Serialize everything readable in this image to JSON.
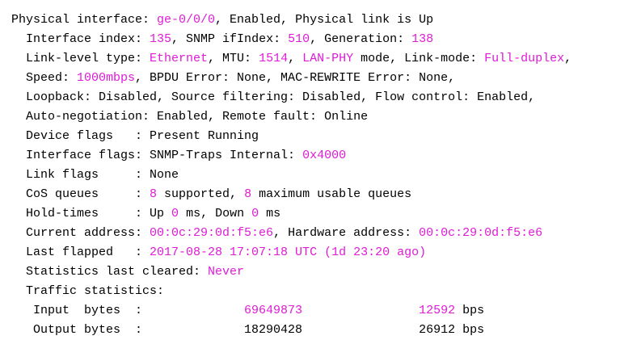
{
  "colors": {
    "text": "#000000",
    "highlight": "#e01bd6",
    "background": "#ffffff"
  },
  "lines": [
    [
      {
        "t": "Physical interface: "
      },
      {
        "t": "ge-0/0/0",
        "hl": true
      },
      {
        "t": ", Enabled, Physical link is Up"
      }
    ],
    [
      {
        "t": "  Interface index: "
      },
      {
        "t": "135",
        "hl": true
      },
      {
        "t": ", SNMP ifIndex: "
      },
      {
        "t": "510",
        "hl": true
      },
      {
        "t": ", Generation: "
      },
      {
        "t": "138",
        "hl": true
      }
    ],
    [
      {
        "t": "  Link-level type: "
      },
      {
        "t": "Ethernet",
        "hl": true
      },
      {
        "t": ", MTU: "
      },
      {
        "t": "1514",
        "hl": true
      },
      {
        "t": ", "
      },
      {
        "t": "LAN-PHY",
        "hl": true
      },
      {
        "t": " mode, Link-mode: "
      },
      {
        "t": "Full-duplex",
        "hl": true
      },
      {
        "t": ","
      }
    ],
    [
      {
        "t": "  Speed: "
      },
      {
        "t": "1000mbps",
        "hl": true
      },
      {
        "t": ", BPDU Error: None, MAC-REWRITE Error: None,"
      }
    ],
    [
      {
        "t": "  Loopback: Disabled, Source filtering: Disabled, Flow control: Enabled,"
      }
    ],
    [
      {
        "t": "  Auto-negotiation: Enabled, Remote fault: Online"
      }
    ],
    [
      {
        "t": "  Device flags   : Present Running"
      }
    ],
    [
      {
        "t": "  Interface flags: SNMP-Traps Internal: "
      },
      {
        "t": "0x4000",
        "hl": true
      }
    ],
    [
      {
        "t": "  Link flags     : None"
      }
    ],
    [
      {
        "t": "  CoS queues     : "
      },
      {
        "t": "8",
        "hl": true
      },
      {
        "t": " supported, "
      },
      {
        "t": "8",
        "hl": true
      },
      {
        "t": " maximum usable queues"
      }
    ],
    [
      {
        "t": "  Hold-times     : Up "
      },
      {
        "t": "0",
        "hl": true
      },
      {
        "t": " ms, Down "
      },
      {
        "t": "0",
        "hl": true
      },
      {
        "t": " ms"
      }
    ],
    [
      {
        "t": "  Current address: "
      },
      {
        "t": "00:0c:29:0d:f5:e6",
        "hl": true
      },
      {
        "t": ", Hardware address: "
      },
      {
        "t": "00:0c:29:0d:f5:e6",
        "hl": true
      }
    ],
    [
      {
        "t": "  Last flapped   : "
      },
      {
        "t": "2017-08-28 17:07:18 UTC (1d 23:20 ago)",
        "hl": true
      }
    ],
    [
      {
        "t": "  Statistics last cleared: "
      },
      {
        "t": "Never",
        "hl": true
      }
    ],
    [
      {
        "t": "  Traffic statistics:"
      }
    ],
    [
      {
        "t": "   Input  bytes  :              "
      },
      {
        "t": "69649873",
        "hl": true
      },
      {
        "t": "                "
      },
      {
        "t": "12592",
        "hl": true
      },
      {
        "t": " bps"
      }
    ],
    [
      {
        "t": "   Output bytes  :              18290428                26912 bps"
      }
    ]
  ]
}
